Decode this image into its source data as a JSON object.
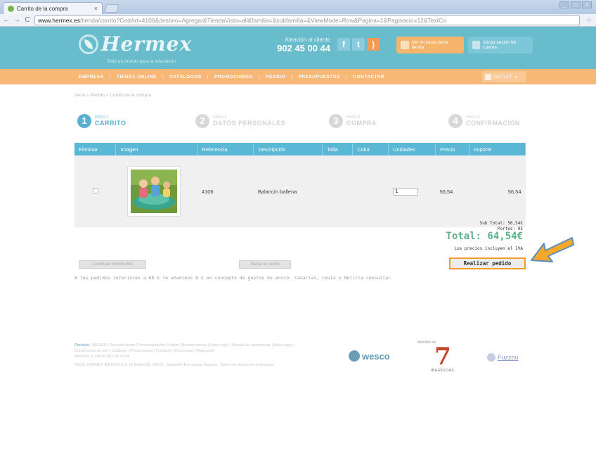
{
  "browser": {
    "tab_title": "Carrito de la compra",
    "tab_close": "×",
    "url_host": "www.hermex.es",
    "url_path": "/tienda/carrito?CodArt=4106&destino=Agregar&TiendaVista=all&familia=&subfamilia=&ViewMode=Row&Pagina=1&Paginacio=12&TextCo",
    "back_glyph": "←",
    "forward_glyph": "→",
    "reload_glyph": "C"
  },
  "header": {
    "logo": "Hermex",
    "tagline": "Todo un mundo para la educación",
    "phone_label": "Atención al cliente",
    "phone_number": "902 45 00 44",
    "catalog_button": "Ver mi cesta de la tienda",
    "login_button": "Iniciar sesión Mi cuenta",
    "colors": {
      "header_bg": "#69bccb",
      "menu_bg": "#f6b777",
      "accent": "#5ab8d6"
    }
  },
  "menu": {
    "items": [
      "EMPRESA",
      "TIENDA ONLINE",
      "CATÁLOGOS",
      "PROMOCIONES",
      "PEDIDO",
      "PRESUPUESTOS",
      "CONTACTAR"
    ],
    "outlet": "OUTLET"
  },
  "breadcrumb": "Inicio > Pedido > Carrito de la compra",
  "steps": [
    {
      "num": "1",
      "small": "PASO 1",
      "title": "CARRITO"
    },
    {
      "num": "2",
      "small": "PASO 2",
      "title": "DATOS PERSONALES"
    },
    {
      "num": "3",
      "small": "PASO 3",
      "title": "COMPRA"
    },
    {
      "num": "4",
      "small": "PASO 4",
      "title": "CONFIRMACIÓN"
    }
  ],
  "table": {
    "headers": [
      "Eliminar",
      "Imagen",
      "Referencia",
      "Descripción",
      "Talla",
      "Color",
      "Unidades",
      "Precio",
      "Importe"
    ],
    "row": {
      "referencia": "4106",
      "descripcion": "Balancín ballena",
      "talla": "",
      "color": "",
      "unidades": "1",
      "precio": "56,54",
      "importe": "56,54"
    }
  },
  "totals": {
    "subtotal": "Sub Total: 56,54€",
    "portes": "Portes: 0€",
    "total": "Total: 64,54€",
    "iva": "Los precios incluyen el IVA"
  },
  "buttons": {
    "continue": "Continuar comprando",
    "empty": "Vaciar el carrito",
    "order": "Realizar pedido"
  },
  "shipping_note": "A los pedidos inferiores a 60 € le añadimos 8 € en concepto de gastos de envío. Canarias, Ceuta y Melilla consultar.",
  "footer": {
    "links_first": "Portada",
    "links_rest": "| WESCO | Nuestra tienda | Personalización Pedido | Nuestra tienda | Aviso legal | Manual de aprendizaje | Aviso legal | Condiciones de uso | Catálogo | Promociones | Contacto | Descargas | Mapa web",
    "contact": "Atención al cliente 902 45 00 44",
    "copyright": "©2011 HERMEX IBÉRICA S.A. C/ Bóbila 68, 08830 - Sabadell (Barcelona) España · Todos los derechos reservados",
    "members_label": "Miembro de",
    "logo_wesco": "wesco",
    "logo_iber_mark": "7",
    "logo_iber": "IBERDIDAC",
    "logo_fuzzou": "Fuzzou"
  }
}
